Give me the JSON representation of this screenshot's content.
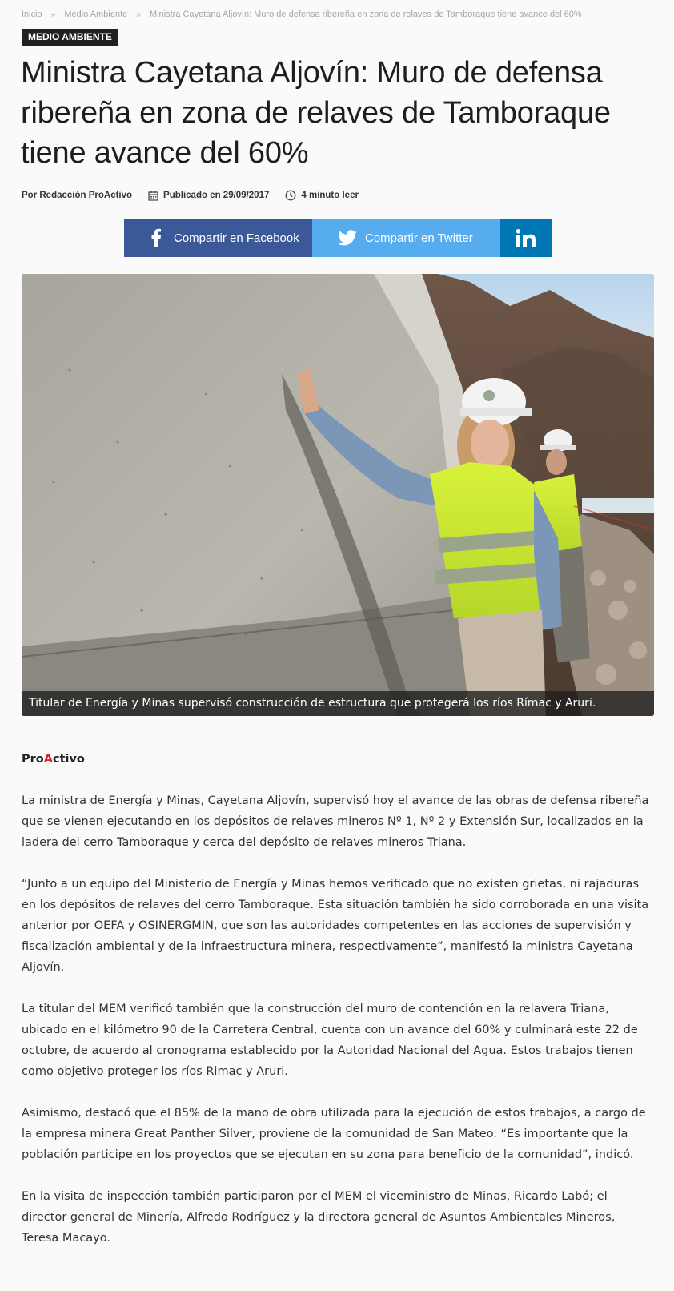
{
  "breadcrumb": {
    "home": "Inicio",
    "category": "Medio Ambiente",
    "current": "Ministra Cayetana Aljovín: Muro de defensa ribereña en zona de relaves de Tamboraque tiene avance del 60%"
  },
  "category_tag": "Medio Ambiente",
  "title": "Ministra Cayetana Aljovín: Muro de defensa ribereña en zona de relaves de Tamboraque tiene avance del 60%",
  "meta": {
    "author": "Por Redacción ProActivo",
    "published": "Publicado en 29/09/2017",
    "read_time": "4 minuto leer"
  },
  "share": {
    "facebook_label": "Compartir en Facebook",
    "twitter_label": "Compartir en Twitter",
    "facebook_color": "#3b5998",
    "twitter_color": "#55acee",
    "linkedin_color": "#0077b5"
  },
  "hero": {
    "caption": "Titular de Energía y Minas supervisó construcción de estructura que protegerá los ríos Rímac y Aruri."
  },
  "article": {
    "source_part1": "Pro",
    "source_part2": "A",
    "source_part3": "ctivo",
    "paragraphs": [
      "La ministra de Energía y Minas, Cayetana Aljovín, supervisó hoy el avance de las obras de defensa ribereña que se vienen ejecutando en los depósitos de relaves mineros  Nº 1, Nº 2 y Extensión Sur, localizados en la ladera del cerro Tamboraque y  cerca del depósito de relaves mineros Triana.",
      "“Junto a un equipo del Ministerio de Energía y Minas hemos verificado que no existen grietas, ni rajaduras en los depósitos de relaves del cerro Tamboraque. Esta situación también ha sido corroborada en una visita anterior por OEFA y OSINERGMIN, que son las autoridades competentes en las acciones de supervisión y fiscalización ambiental y de la infraestructura minera, respectivamente”, manifestó la ministra Cayetana Aljovín.",
      "La titular del MEM verificó también que la construcción del muro de contención en la relavera Triana, ubicado en el kilómetro 90 de la Carretera Central, cuenta con un avance del 60% y culminará este 22 de octubre, de acuerdo al cronograma establecido por la Autoridad Nacional del Agua. Estos trabajos tienen como objetivo proteger los ríos Rimac y Aruri.",
      "Asimismo, destacó que el 85% de la mano de obra utilizada para la ejecución de estos trabajos, a cargo de la empresa minera Great Panther Silver, proviene de la comunidad de San Mateo. “Es importante que la población participe en los proyectos que se ejecutan en su zona para beneficio de la comunidad”, indicó.",
      "En la visita de inspección también participaron por el MEM el viceministro de Minas, Ricardo Labó; el director general de Minería, Alfredo Rodríguez y la directora general de Asuntos Ambientales Mineros, Teresa Macayo."
    ]
  }
}
